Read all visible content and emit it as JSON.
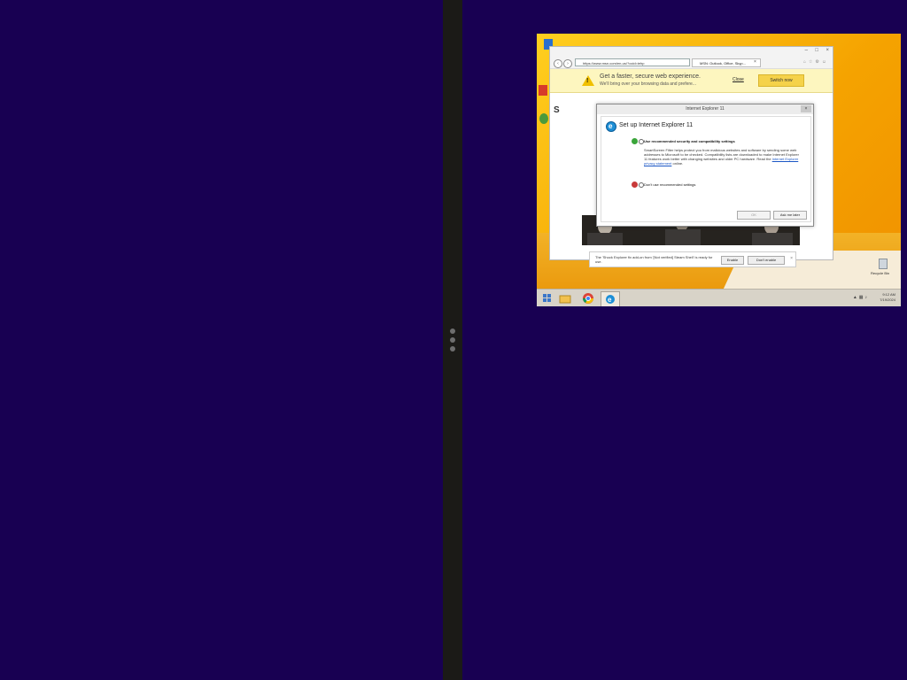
{
  "browser": {
    "address": "https://www.msn.com/en-us/?ocid=iehp",
    "tab_label": "MSN: Outlook, Office, Skyp...",
    "tab_close": "×",
    "title_controls": [
      "–",
      "□",
      "×"
    ]
  },
  "notification": {
    "title": "Get a faster, secure web experience.",
    "subtitle": "We'll bring over your browsing data and prefere...",
    "close_label": "Close",
    "switch_label": "Switch now"
  },
  "dialog": {
    "window_title": "Internet Explorer 11",
    "close_label": "×",
    "heading": "Set up Internet Explorer 11",
    "option1_label": "Use recommended security and compatibility settings",
    "option1_desc_pre": "SmartScreen Filter helps protect you from malicious websites and software by sending some web addresses to Microsoft to be checked. Compatibility lists are downloaded to make Internet Explorer 11 features work better with changing websites and older PC hardware. Read the ",
    "option1_desc_link": "Internet Explorer privacy statement",
    "option1_desc_post": " online.",
    "option2_label": "Don't use recommended settings",
    "ok_label": "OK",
    "ask_later_label": "Ask me later"
  },
  "addon_bar": {
    "text": "The 'Shock Explorer fix add-on from '[Not verified] Steam Shell' is ready for use.",
    "enable_label": "Enable",
    "dont_enable_label": "Don't enable",
    "close_label": "×"
  },
  "desktop": {
    "recycle_bin_label": "Recycle Bin"
  },
  "taskbar": {
    "time": "9:12 AM",
    "date": "7/19/2024"
  },
  "colors": {
    "backdrop": "#180052",
    "splitter": "#1b1a17",
    "accent_yellow": "#f5a300",
    "ie_blue": "#1e8fd6"
  }
}
